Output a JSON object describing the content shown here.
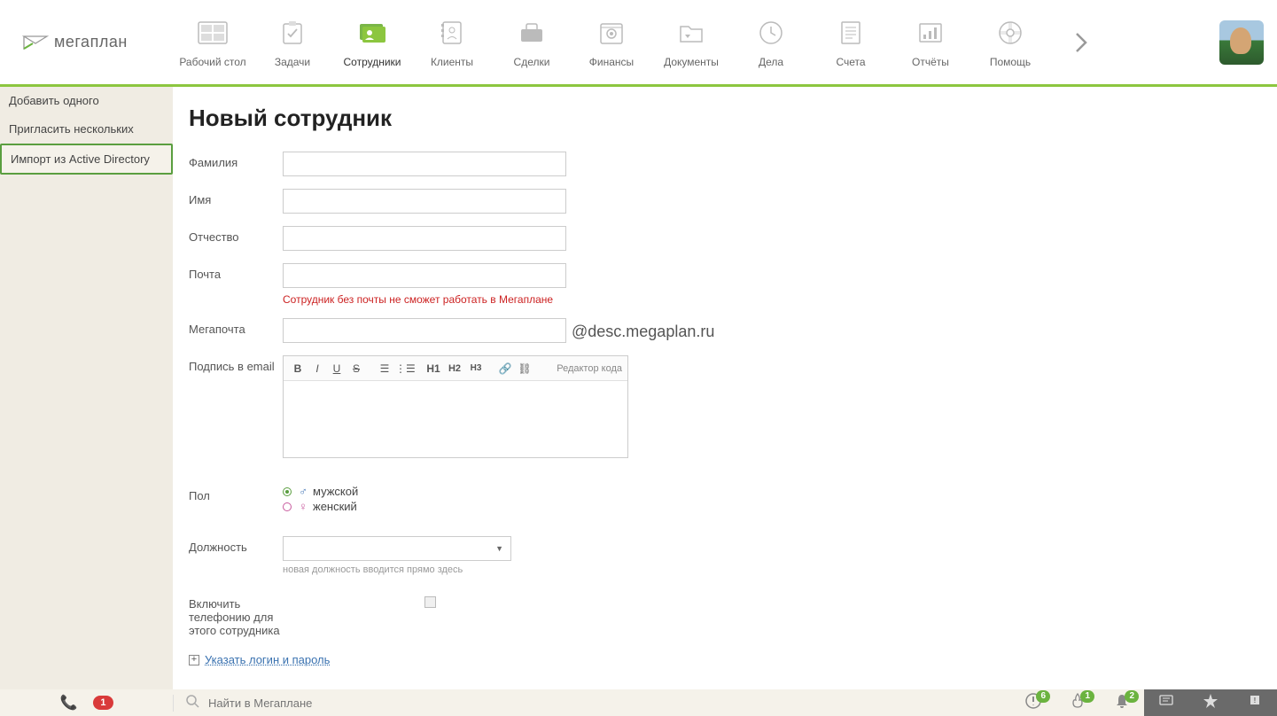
{
  "logo_text": "мегаплан",
  "nav": {
    "items": [
      {
        "label": "Рабочий стол"
      },
      {
        "label": "Задачи"
      },
      {
        "label": "Сотрудники"
      },
      {
        "label": "Клиенты"
      },
      {
        "label": "Сделки"
      },
      {
        "label": "Финансы"
      },
      {
        "label": "Документы"
      },
      {
        "label": "Дела"
      },
      {
        "label": "Счета"
      },
      {
        "label": "Отчёты"
      },
      {
        "label": "Помощь"
      }
    ]
  },
  "sidebar": {
    "items": [
      {
        "label": "Добавить одного"
      },
      {
        "label": "Пригласить нескольких"
      },
      {
        "label": "Импорт из Active Directory"
      }
    ]
  },
  "page": {
    "title": "Новый сотрудник"
  },
  "form": {
    "surname_label": "Фамилия",
    "name_label": "Имя",
    "patronymic_label": "Отчество",
    "email_label": "Почта",
    "email_hint": "Сотрудник без почты не сможет работать в Мегаплане",
    "megamail_label": "Мегапочта",
    "megamail_suffix": "@desc.megaplan.ru",
    "signature_label": "Подпись в email",
    "editor": {
      "b": "B",
      "i": "I",
      "u": "U",
      "s": "S",
      "h1": "H1",
      "h2": "H2",
      "h3": "H3",
      "code": "Редактор кода"
    },
    "gender_label": "Пол",
    "gender_male": "мужской",
    "gender_female": "женский",
    "position_label": "Должность",
    "position_hint": "новая должность вводится прямо здесь",
    "telephony_label": "Включить телефонию для этого сотрудника",
    "login_link": "Указать логин и пароль"
  },
  "footer": {
    "phone_badge": "1",
    "search_placeholder": "Найти в Мегаплане",
    "badges": {
      "alert": "6",
      "fire": "1",
      "bell": "2"
    }
  }
}
